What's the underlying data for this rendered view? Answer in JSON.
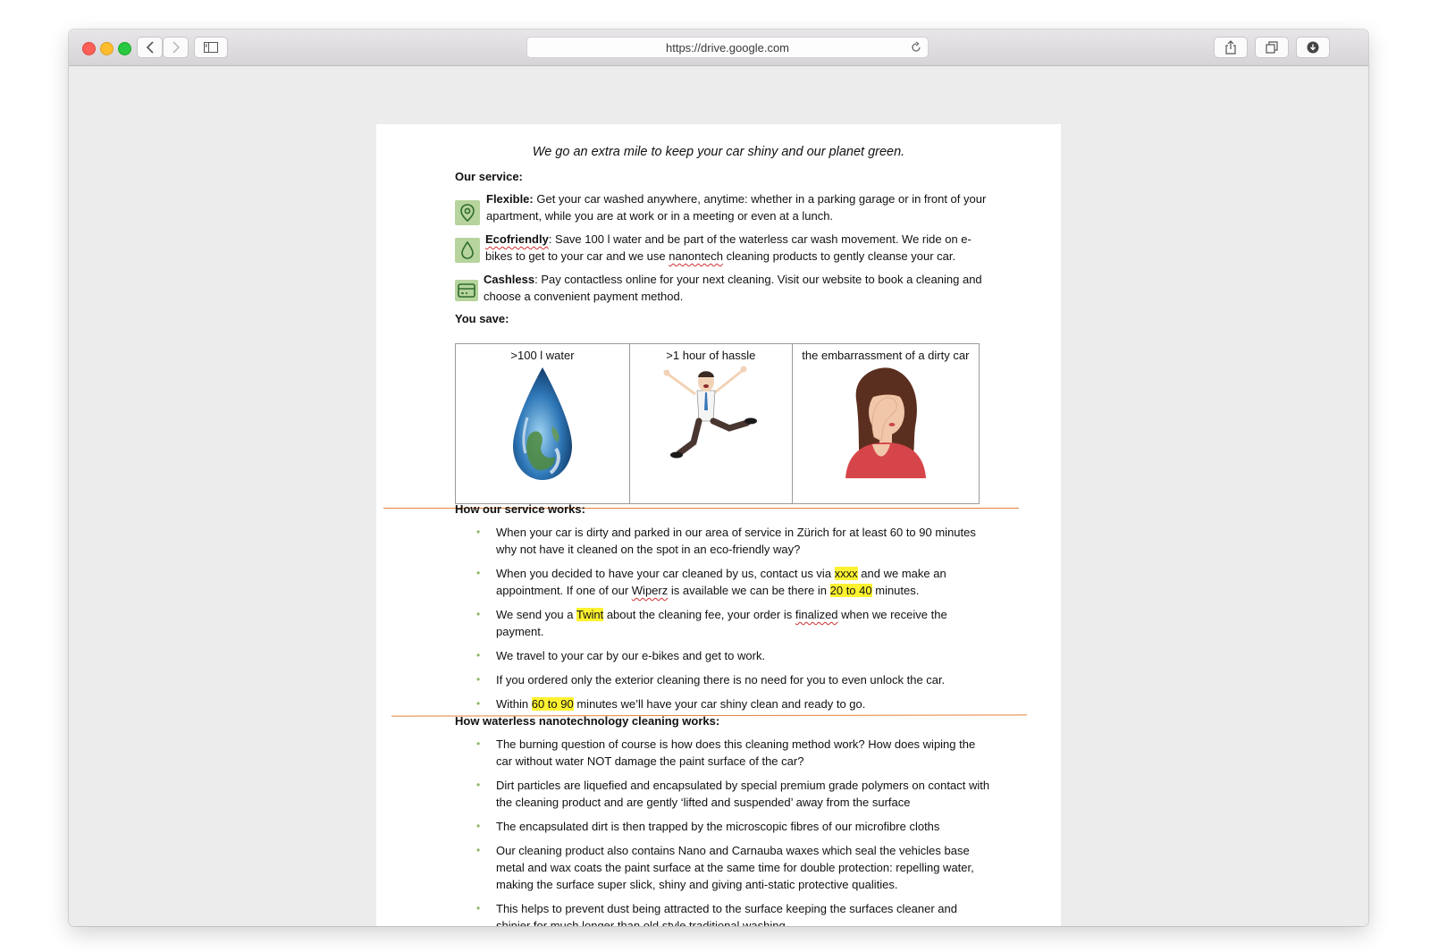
{
  "browser": {
    "url": "https://drive.google.com"
  },
  "document": {
    "tagline": "We go an extra mile to keep your car shiny and our planet green.",
    "service_heading": "Our service:",
    "features": [
      {
        "title": "Flexible:",
        "text": " Get your car washed anywhere, anytime: whether in a parking garage or in front of your apartment, while you are at work or in a meeting or even at a lunch.",
        "icon": "location-pin-icon"
      },
      {
        "title": "Ecofriendly",
        "text": ": Save 100 l water and be part of the waterless car wash movement. We ride on e-bikes to get to your car and we use ",
        "spell": "nanontech",
        "text_after": " cleaning products to gently cleanse your car.",
        "icon": "water-drop-icon"
      },
      {
        "title": "Cashless",
        "text": ": Pay contactless online for your next cleaning. Visit our website to book a cleaning and choose a convenient payment method.",
        "icon": "credit-card-icon"
      }
    ],
    "save_heading": "You save:",
    "save_table": [
      ">100 l water",
      ">1 hour of hassle",
      "the embarrassment of a dirty car"
    ],
    "how_heading": "How our service works:",
    "how_items": {
      "i1": "When your car is dirty and parked in our area of service in Zürich for at least 60 to 90 minutes why not have it cleaned on the spot in an eco-friendly way?",
      "i2_a": "When you decided to have your car cleaned by us, contact us via ",
      "i2_hl1": "xxxx",
      "i2_b": " and we make an appointment. If one of our ",
      "i2_spell": "Wiperz",
      "i2_c": " is available we can be there in ",
      "i2_hl2": "20 to 40",
      "i2_d": " minutes.",
      "i3_a": "We send you a ",
      "i3_hl": "Twint",
      "i3_b": " about the cleaning fee, your order is ",
      "i3_spell": "finalized",
      "i3_c": " when we receive the payment.",
      "i4": "We travel to your car by our e-bikes and get to work.",
      "i5": "If you ordered only the exterior cleaning there is no need for you to even unlock the car.",
      "i6_a": "Within ",
      "i6_hl": "60 to 90",
      "i6_b": " minutes we’ll have your car shiny clean and ready to go."
    },
    "nano_heading": "How waterless nanotechnology cleaning works:",
    "nano_items": [
      "The burning question of course is how does this cleaning method work? How does wiping the car without water NOT damage the paint surface of the car?",
      "Dirt particles are liquefied and encapsulated by special premium grade polymers on contact with the cleaning product and are gently ‘lifted and suspended’ away from the surface",
      "The encapsulated dirt is then trapped by the microscopic fibres of our microfibre cloths",
      "Our cleaning product also contains Nano and Carnauba waxes which seal the vehicles base metal and wax coats the paint surface at the same time for double protection: repelling water, making the surface super slick, shiny and giving anti-static protective qualities.",
      "This helps to prevent dust being attracted to the surface keeping the surfaces cleaner and shinier for much longer than old style traditional washing."
    ]
  }
}
